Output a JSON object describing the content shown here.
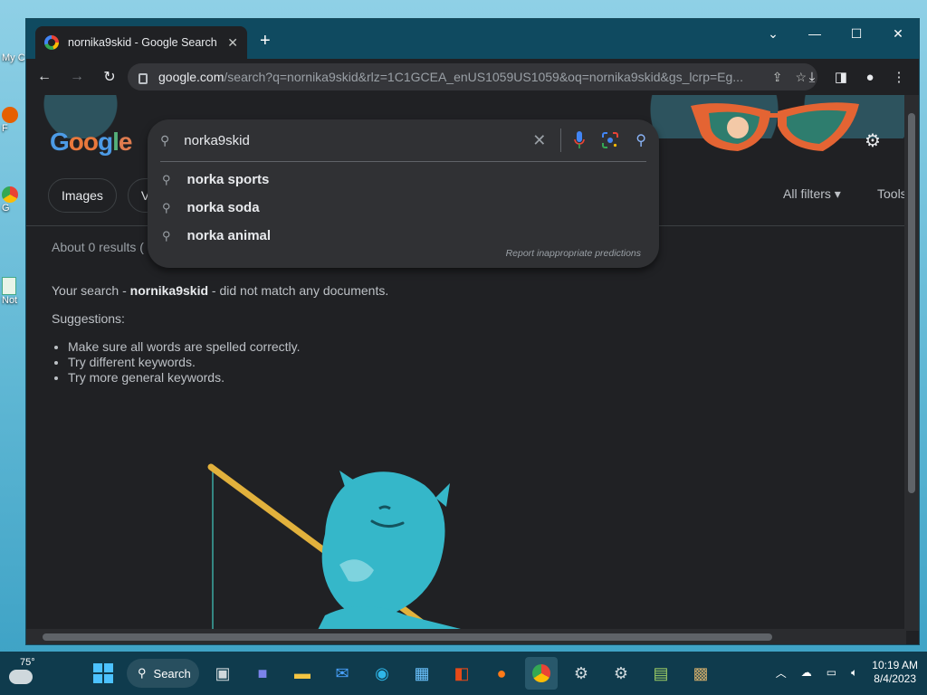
{
  "desktop": {
    "icons": [
      "My C",
      "F",
      "G",
      "Ch",
      "Not"
    ]
  },
  "browser": {
    "tab_title": "nornika9skid - Google Search",
    "url_host": "google.com",
    "url_rest": "/search?q=nornika9skid&rlz=1C1GCEA_enUS1059US1059&oq=nornika9skid&gs_lcrp=Eg..."
  },
  "search": {
    "query": "norka9skid",
    "suggestions": [
      "norka sports",
      "norka soda",
      "norka animal"
    ],
    "report": "Report inappropriate predictions"
  },
  "logo": [
    "G",
    "o",
    "o",
    "g",
    "l",
    "e"
  ],
  "chips": [
    "Images",
    "Vi"
  ],
  "filters_label": "All filters",
  "tools_label": "Tools",
  "results": {
    "stats": "About 0 results (",
    "msg_prefix": "Your search - ",
    "msg_query": "nornika9skid",
    "msg_suffix": " - did not match any documents.",
    "suggestions_title": "Suggestions:",
    "tips": [
      "Make sure all words are spelled correctly.",
      "Try different keywords.",
      "Try more general keywords."
    ]
  },
  "taskbar": {
    "temperature": "75°",
    "search_label": "Search",
    "time": "10:19 AM",
    "date": "8/4/2023"
  },
  "colors": {
    "accent": "#8ab4f8",
    "titlebar": "#0f4a60",
    "page_bg": "#202124"
  }
}
